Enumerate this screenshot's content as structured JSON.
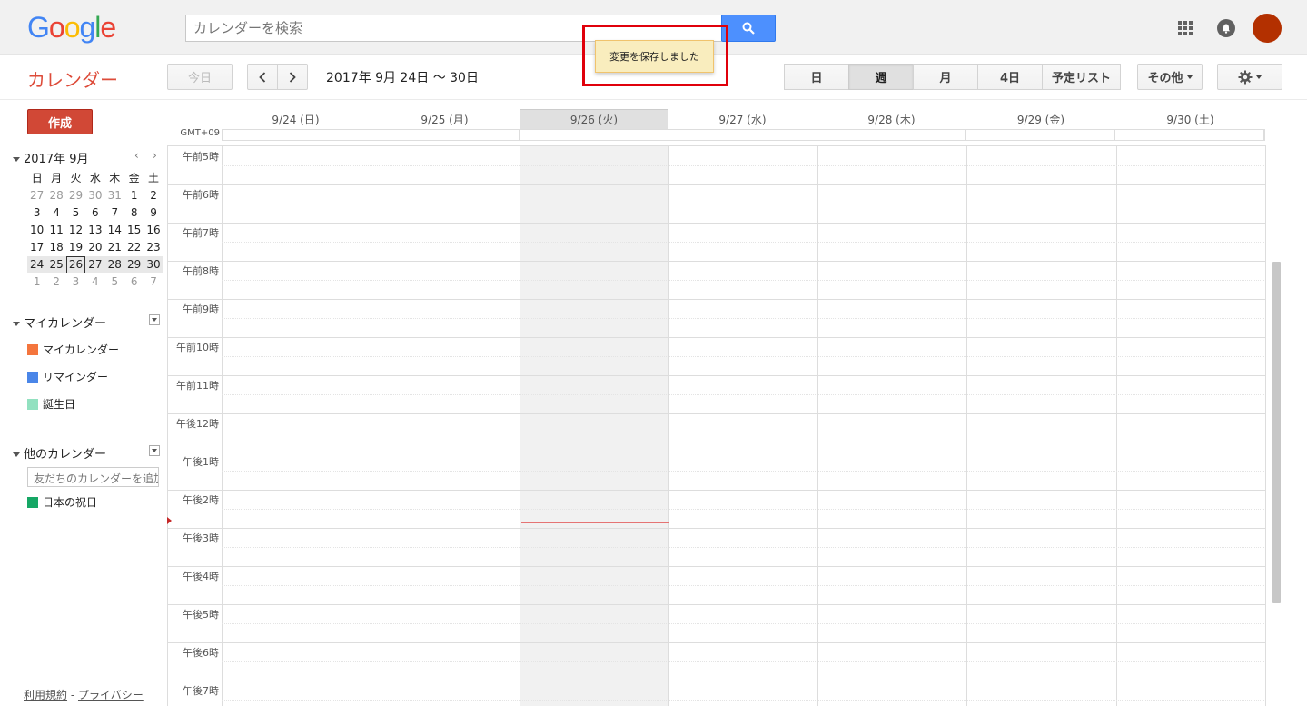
{
  "header": {
    "logo": [
      "G",
      "o",
      "o",
      "g",
      "l",
      "e"
    ],
    "logo_colors": [
      "#4285f4",
      "#ea4335",
      "#fbbc05",
      "#4285f4",
      "#34a853",
      "#ea4335"
    ],
    "search_placeholder": "カレンダーを検索"
  },
  "toast": {
    "text": "変更を保存しました"
  },
  "toolbar": {
    "app_title": "カレンダー",
    "today_label": "今日",
    "date_range": "2017年 9月 24日 〜 30日",
    "views": [
      {
        "label": "日",
        "w": 72
      },
      {
        "label": "週",
        "w": 72,
        "active": true
      },
      {
        "label": "月",
        "w": 72
      },
      {
        "label": "4日",
        "w": 72
      },
      {
        "label": "予定リスト",
        "w": 87
      }
    ],
    "more_label": "その他"
  },
  "sidebar": {
    "create_label": "作成",
    "mini_title": "2017年 9月",
    "weekday_headers": [
      "日",
      "月",
      "火",
      "水",
      "木",
      "金",
      "土"
    ],
    "weeks": [
      [
        {
          "d": "27",
          "dim": true
        },
        {
          "d": "28",
          "dim": true
        },
        {
          "d": "29",
          "dim": true
        },
        {
          "d": "30",
          "dim": true
        },
        {
          "d": "31",
          "dim": true
        },
        {
          "d": "1"
        },
        {
          "d": "2"
        }
      ],
      [
        {
          "d": "3"
        },
        {
          "d": "4"
        },
        {
          "d": "5"
        },
        {
          "d": "6"
        },
        {
          "d": "7"
        },
        {
          "d": "8"
        },
        {
          "d": "9"
        }
      ],
      [
        {
          "d": "10"
        },
        {
          "d": "11"
        },
        {
          "d": "12"
        },
        {
          "d": "13"
        },
        {
          "d": "14"
        },
        {
          "d": "15"
        },
        {
          "d": "16"
        }
      ],
      [
        {
          "d": "17"
        },
        {
          "d": "18"
        },
        {
          "d": "19"
        },
        {
          "d": "20"
        },
        {
          "d": "21"
        },
        {
          "d": "22"
        },
        {
          "d": "23"
        }
      ],
      [
        {
          "d": "24"
        },
        {
          "d": "25"
        },
        {
          "d": "26",
          "today": true
        },
        {
          "d": "27"
        },
        {
          "d": "28"
        },
        {
          "d": "29"
        },
        {
          "d": "30"
        }
      ],
      [
        {
          "d": "1",
          "dim": true
        },
        {
          "d": "2",
          "dim": true
        },
        {
          "d": "3",
          "dim": true
        },
        {
          "d": "4",
          "dim": true
        },
        {
          "d": "5",
          "dim": true
        },
        {
          "d": "6",
          "dim": true
        },
        {
          "d": "7",
          "dim": true
        }
      ]
    ],
    "highlight_week": 4,
    "my_calendars_title": "マイカレンダー",
    "my_calendars": [
      {
        "name": "マイカレンダー",
        "color": "#f4753d"
      },
      {
        "name": "リマインダー",
        "color": "#4a86e8"
      },
      {
        "name": "誕生日",
        "color": "#92e1c0"
      }
    ],
    "other_calendars_title": "他のカレンダー",
    "add_friend_placeholder": "友だちのカレンダーを追加",
    "other_calendars": [
      {
        "name": "日本の祝日",
        "color": "#16a765"
      }
    ],
    "footer_terms": "利用規約",
    "footer_sep": " - ",
    "footer_privacy": "プライバシー"
  },
  "week": {
    "timezone": "GMT+09",
    "days": [
      {
        "label": "9/24 (日)"
      },
      {
        "label": "9/25 (月)"
      },
      {
        "label": "9/26 (火)",
        "today": true
      },
      {
        "label": "9/27 (水)"
      },
      {
        "label": "9/28 (木)"
      },
      {
        "label": "9/29 (金)"
      },
      {
        "label": "9/30 (土)"
      }
    ],
    "hours": [
      "午前5時",
      "午前6時",
      "午前7時",
      "午前8時",
      "午前9時",
      "午前10時",
      "午前11時",
      "午後12時",
      "午後1時",
      "午後2時",
      "午後3時",
      "午後4時",
      "午後5時",
      "午後6時",
      "午後7時"
    ]
  }
}
